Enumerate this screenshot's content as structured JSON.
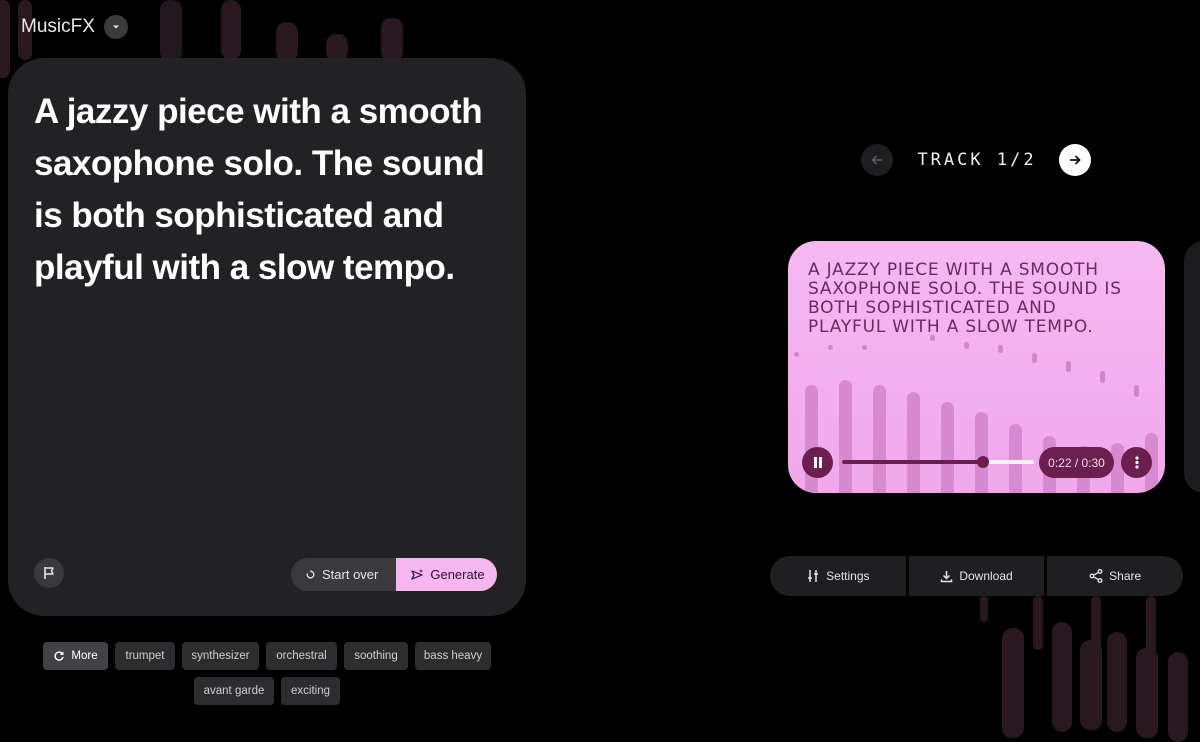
{
  "app": {
    "title": "MusicFX"
  },
  "prompt": {
    "text": "A jazzy piece with a smooth saxophone solo. The sound is both sophisticated and playful with a slow tempo.",
    "start_over_label": "Start over",
    "generate_label": "Generate"
  },
  "chips": {
    "more_label": "More",
    "items": [
      "trumpet",
      "synthesizer",
      "orchestral",
      "soothing",
      "bass heavy",
      "avant garde",
      "exciting"
    ]
  },
  "track": {
    "label": "TRACK 1/2",
    "title": "A JAZZY PIECE WITH A SMOOTH SAXOPHONE SOLO. THE SOUND IS BOTH SOPHISTICATED AND PLAYFUL WITH A SLOW TEMPO.",
    "time": "0:22 / 0:30",
    "progress": 0.733
  },
  "actions": {
    "settings_label": "Settings",
    "download_label": "Download",
    "share_label": "Share"
  },
  "colors": {
    "accent_pink": "#f6b6f0",
    "player_dark": "#6b1f4f",
    "card_bg": "#222224"
  }
}
